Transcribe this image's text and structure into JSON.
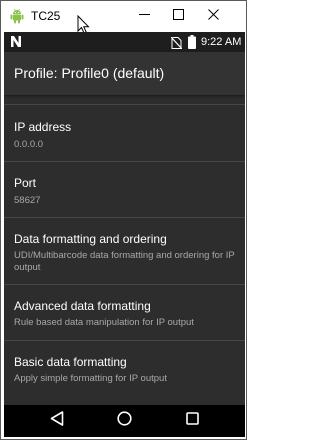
{
  "window": {
    "title": "TC25",
    "icon": "android-icon",
    "controls": [
      "minimize-icon",
      "maximize-icon",
      "close-icon"
    ]
  },
  "status_bar": {
    "time": "9:22 AM",
    "icons": [
      "notification-n-icon",
      "no-sim-icon",
      "battery-icon"
    ]
  },
  "app_bar": {
    "title": "Profile: Profile0 (default)"
  },
  "list": {
    "items": [
      {
        "title": "IP address",
        "subtitle": "0.0.0.0"
      },
      {
        "title": "Port",
        "subtitle": "58627"
      },
      {
        "title": "Data formatting and ordering",
        "subtitle": "UDI/Multibarcode data formatting and ordering for IP output"
      },
      {
        "title": "Advanced data formatting",
        "subtitle": "Rule based data manipulation for IP output"
      },
      {
        "title": "Basic data formatting",
        "subtitle": "Apply simple formatting for IP output"
      }
    ]
  },
  "nav_bar": {
    "buttons": [
      "back-icon",
      "home-icon",
      "recent-apps-icon"
    ]
  },
  "colors": {
    "screen_bg": "#2d2d2d",
    "app_bar_bg": "#333333",
    "status_bar_bg": "#1e1e1e",
    "nav_bar_bg": "#000000",
    "primary_text": "#ffffff",
    "secondary_text": "#a8a8a8",
    "android_green": "#8bc34a"
  }
}
